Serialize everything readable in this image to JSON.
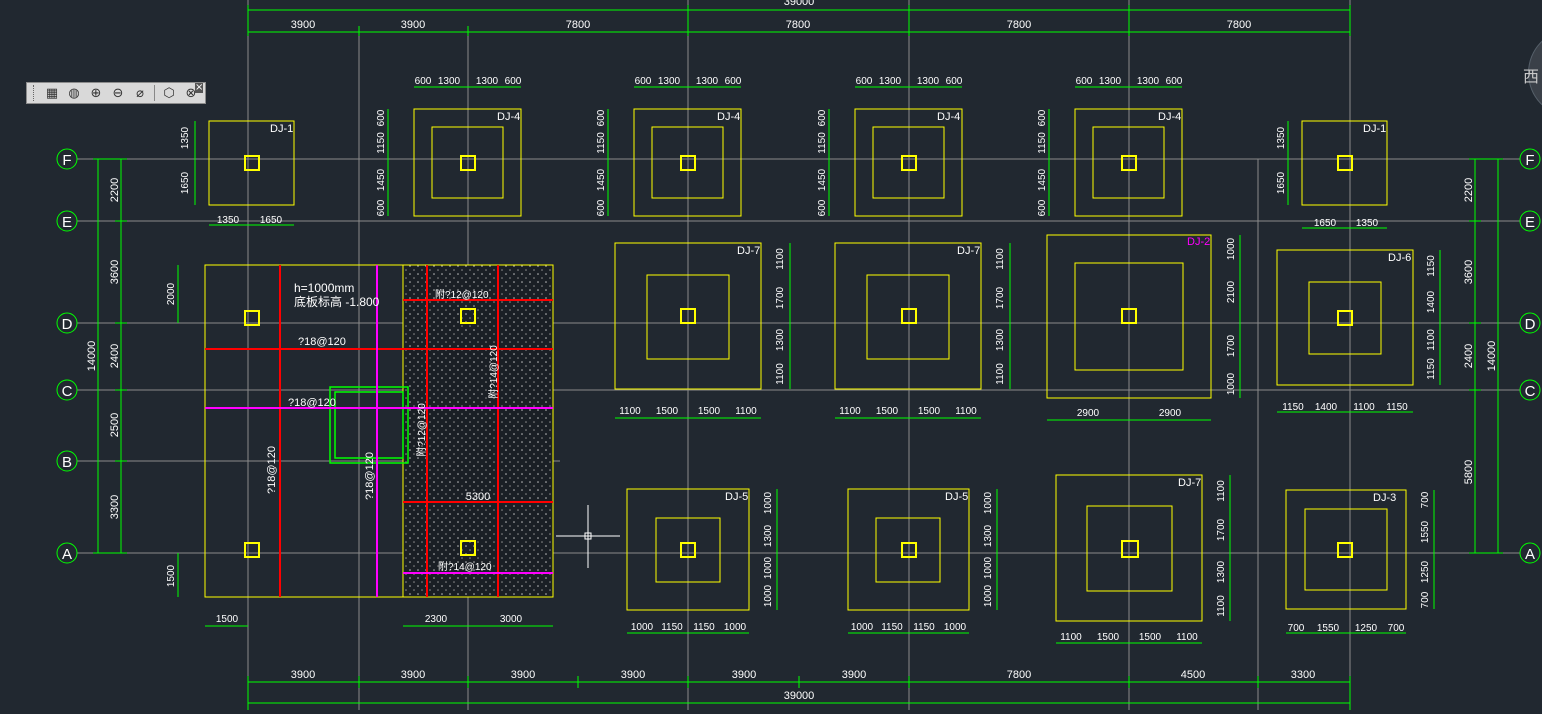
{
  "colors": {
    "background": "#212830",
    "grid": "#8a8a8a",
    "dimension": "#00ff00",
    "footing": "#ffff00",
    "label": "#ffffff",
    "rebar": "#ff0000",
    "magenta": "#ff00ff"
  },
  "toolbar": {
    "buttons": [
      "viewport-icon",
      "sphere-icon",
      "sphere-add-icon",
      "sphere-remove-icon",
      "sphere-slash-icon",
      "box-icon",
      "delete-sphere-icon"
    ],
    "glyphs": [
      "▦",
      "◍",
      "⊕",
      "⊖",
      "⌀",
      "⬡",
      "⊗"
    ],
    "close": "×"
  },
  "viewcube": {
    "label": "西"
  },
  "axes": {
    "left": [
      "F",
      "E",
      "D",
      "C",
      "B",
      "A"
    ],
    "right": [
      "F",
      "E",
      "D",
      "C",
      "A"
    ]
  },
  "top_dims": {
    "total": "39000",
    "spans": [
      "3900",
      "3900",
      "7800",
      "7800",
      "7800",
      "7800"
    ]
  },
  "bottom_dims": {
    "total": "39000",
    "spans": [
      "3900",
      "3900",
      "3900",
      "3900",
      "3900",
      "3900",
      "7800",
      "4500",
      "3300"
    ]
  },
  "left_dims": {
    "segments": [
      "2200",
      "3600",
      "2400",
      "2500",
      "3300"
    ],
    "total": "14000"
  },
  "right_dims": {
    "segments": [
      "2200",
      "3600",
      "2400",
      "5800"
    ],
    "total": "14000"
  },
  "footings": {
    "dj1_left": {
      "name": "DJ-1",
      "dims_v": [
        "1350",
        "1650"
      ],
      "dims_h": [
        "1350",
        "1650"
      ]
    },
    "dj4": {
      "name": "DJ-4",
      "dims_top": [
        "600",
        "1300",
        "1300",
        "600"
      ],
      "dims_v": [
        "600",
        "1150",
        "1450",
        "600"
      ]
    },
    "dj1_right": {
      "name": "DJ-1",
      "dims_v": [
        "1350",
        "1650"
      ],
      "dims_h": [
        "1650",
        "1350"
      ]
    },
    "dj7_a": {
      "name": "DJ-7",
      "dims_v": [
        "1100",
        "1700",
        "1300",
        "1100"
      ],
      "dims_h": [
        "1100",
        "1500",
        "1500",
        "1100"
      ]
    },
    "dj2": {
      "name": "DJ-2",
      "dims_v": [
        "1000",
        "2100",
        "1700",
        "1000"
      ],
      "dims_h": [
        "2900",
        "2900"
      ]
    },
    "dj6": {
      "name": "DJ-6",
      "dims_v": [
        "1150",
        "1400",
        "1100",
        "1150"
      ],
      "dims_h": [
        "1150",
        "1400",
        "1100",
        "1150"
      ]
    },
    "dj5": {
      "name": "DJ-5",
      "dims_v": [
        "1000",
        "1300",
        "1000",
        "1000"
      ],
      "dims_h": [
        "1000",
        "1150",
        "1150",
        "1000"
      ]
    },
    "dj7_b": {
      "name": "DJ-7",
      "dims_v": [
        "1100",
        "1700",
        "1300",
        "1100"
      ],
      "dims_h": [
        "1100",
        "1500",
        "1500",
        "1100"
      ]
    },
    "dj3": {
      "name": "DJ-3",
      "dims_v": [
        "700",
        "1550",
        "1250",
        "700"
      ],
      "dims_h": [
        "700",
        "1550",
        "1250",
        "700"
      ]
    }
  },
  "raft": {
    "thickness": "h=1000mm",
    "elevation": "底板标高 -1.800",
    "rebar_h1": "?18@120",
    "rebar_h2": "?18@120",
    "rebar_v1": "?18@120",
    "rebar_v2": "?18@120",
    "hatch_top": "附?12@120",
    "hatch_v1": "附?14@120",
    "hatch_v2": "附?12@120",
    "hatch_bottom": "附?14@120",
    "hatch_span": "5300",
    "dim_left_top": "2000",
    "dim_left_bottom": "1500",
    "dim_bottom_a": "1500",
    "dim_bottom_b": "2300",
    "dim_bottom_c": "3000"
  }
}
